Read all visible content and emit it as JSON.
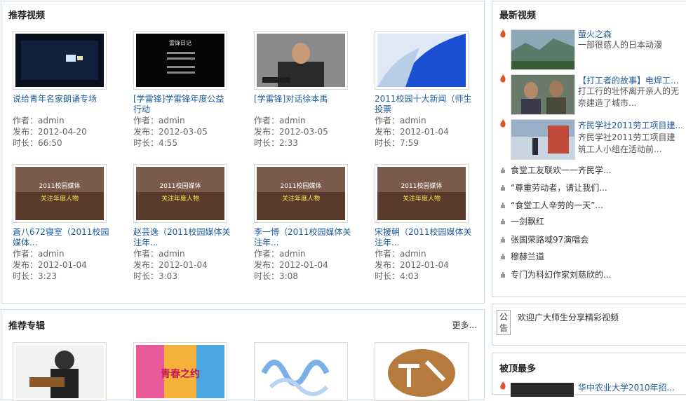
{
  "recommended_videos": {
    "title": "推荐视频",
    "items": [
      {
        "title": "说给青年名家朗诵专场",
        "author": "作者：admin",
        "date": "发布：2012-04-20",
        "duration": "时长：66:50"
      },
      {
        "title": "[学雷锋]学雷锋年度公益行动",
        "author": "作者：admin",
        "date": "发布：2012-03-05",
        "duration": "时长：4:55"
      },
      {
        "title": "[学雷锋]对话徐本禹",
        "author": "作者：admin",
        "date": "发布：2012-03-05",
        "duration": "时长：2:33"
      },
      {
        "title": "2011校园十大新闻（师生投票",
        "author": "作者：admin",
        "date": "发布：2012-01-04",
        "duration": "时长：7:59"
      },
      {
        "title": "蒼八672寝室（2011校园媒体...",
        "author": "作者：admin",
        "date": "发布：2012-01-04",
        "duration": "时长：3:23"
      },
      {
        "title": "赵芸逸（2011校园媒体关注年...",
        "author": "作者：admin",
        "date": "发布：2012-01-04",
        "duration": "时长：3:03"
      },
      {
        "title": "李一博（2011校园媒体关注年...",
        "author": "作者：admin",
        "date": "发布：2012-01-04",
        "duration": "时长：3:08"
      },
      {
        "title": "宋援朝（2011校园媒体关注年...",
        "author": "作者：admin",
        "date": "发布：2012-01-04",
        "duration": "时长：4:03"
      }
    ],
    "thumb_texts": {
      "leifeng": "雷锋日记",
      "media1": "2011校园媒体",
      "media2": "关注年度人物"
    }
  },
  "recommended_albums": {
    "title": "推荐专辑",
    "more": "更多...",
    "thumb_texts": {
      "youth": "青春之约"
    }
  },
  "latest_videos": {
    "title": "最新视频",
    "featured": [
      {
        "title": "萤火之森",
        "desc": "一部很感人的日本动漫"
      },
      {
        "title": "【打工者的故事】电焊工...",
        "desc": "打工行的壮怀离开亲人的无奈建造了城市..."
      },
      {
        "title": "齐民学社2011劳工项目建...",
        "desc": "齐民学社2011劳工项目建筑工人小组在活动前..."
      }
    ],
    "list": [
      "食堂工友联欢一一齐民学...",
      "“尊重劳动者，请让我们...",
      "“食堂工人辛劳的一天”...",
      "一剑飘红",
      "张国荣路域97演唱会",
      "穆赫兰道",
      "专门为科幻作家刘慈欣的..."
    ]
  },
  "notice": {
    "label": "公告",
    "text": "欢迎广大师生分享精彩视频"
  },
  "most_liked": {
    "title": "被顶最多",
    "first": "华中农业大学2010年招..."
  },
  "colors": {
    "link": "#1f5c9c",
    "border": "#c9d9e9",
    "fire": "#e0522b"
  }
}
